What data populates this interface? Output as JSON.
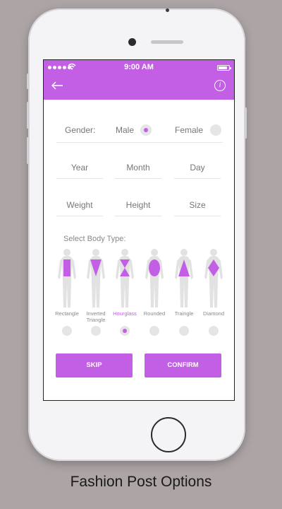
{
  "status": {
    "time": "9:00 AM"
  },
  "form": {
    "gender_label": "Gender:",
    "male_label": "Male",
    "female_label": "Female",
    "gender_selected": "Male",
    "year_placeholder": "Year",
    "month_placeholder": "Month",
    "day_placeholder": "Day",
    "weight_placeholder": "Weight",
    "height_placeholder": "Height",
    "size_placeholder": "Size",
    "body_type_label": "Select Body Type:",
    "body_types": [
      {
        "label": "Rectangle",
        "shape": "rectangle",
        "selected": false
      },
      {
        "label": "Inverted Triangle",
        "shape": "inverted-triangle",
        "selected": false
      },
      {
        "label": "Hourglass",
        "shape": "hourglass",
        "selected": true
      },
      {
        "label": "Rounded",
        "shape": "ellipse",
        "selected": false
      },
      {
        "label": "Traingle",
        "shape": "triangle",
        "selected": false
      },
      {
        "label": "Diamond",
        "shape": "diamond",
        "selected": false
      }
    ]
  },
  "buttons": {
    "skip": "SKIP",
    "confirm": "CONFIRM"
  },
  "caption": "Fashion Post Options",
  "colors": {
    "accent": "#c25fe5",
    "background": "#aca4a5"
  },
  "icons": {
    "back": "arrow-left-icon",
    "info": "info-icon"
  }
}
